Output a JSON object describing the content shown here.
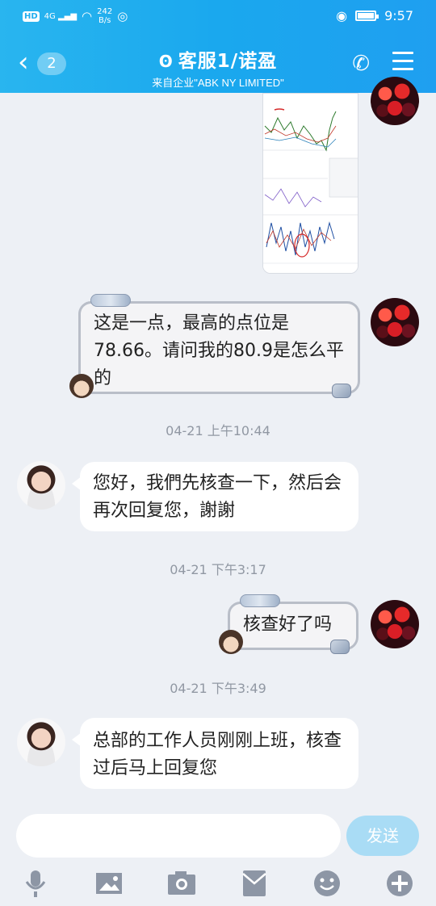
{
  "status_bar": {
    "hd": "HD",
    "signal": "4G",
    "net_speed": "242",
    "net_unit": "B/s",
    "time": "9:57"
  },
  "header": {
    "back_count": "2",
    "title": "客服1/诺盈",
    "subtitle": "来自企业\"ABK NY LIMITED\""
  },
  "messages": [
    {
      "type": "image",
      "side": "right"
    },
    {
      "type": "text",
      "side": "right",
      "text": "这是一点，最高的点位是78.66。请问我的80.9是怎么平的"
    },
    {
      "type": "time",
      "text": "04-21 上午10:44"
    },
    {
      "type": "text",
      "side": "left",
      "text": "您好，我們先核查一下，然后会再次回复您，謝謝"
    },
    {
      "type": "time",
      "text": "04-21 下午3:17"
    },
    {
      "type": "text",
      "side": "right",
      "text": "核查好了吗"
    },
    {
      "type": "time",
      "text": "04-21 下午3:49"
    },
    {
      "type": "text",
      "side": "left",
      "text": "总部的工作人员刚刚上班，核查过后马上回复您"
    }
  ],
  "input": {
    "placeholder": "",
    "send_label": "发送"
  },
  "toolbar": [
    "microphone-icon",
    "image-icon",
    "camera-icon",
    "red-envelope-icon",
    "emoji-icon",
    "plus-icon"
  ],
  "colors": {
    "header": "#1fa9ef",
    "send": "#a9dcf5",
    "background": "#edf0f5"
  }
}
